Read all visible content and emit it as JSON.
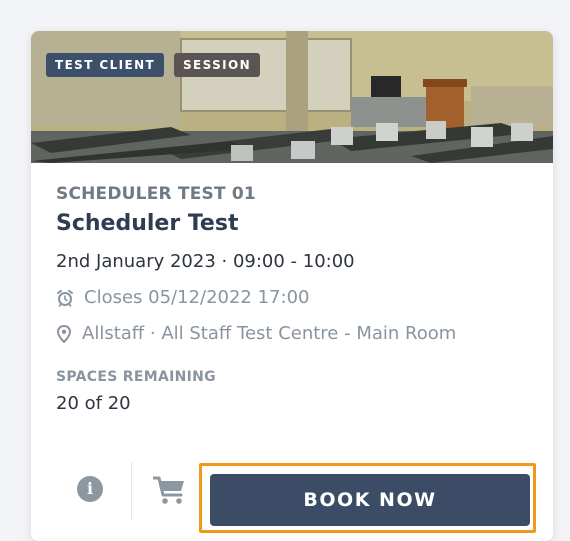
{
  "tags": {
    "client": "TEST CLIENT",
    "session": "SESSION"
  },
  "event": {
    "code": "SCHEDULER TEST 01",
    "title": "Scheduler Test",
    "datetime": "2nd January 2023 · 09:00 - 10:00",
    "closes": "Closes 05/12/2022 17:00",
    "location": "Allstaff · All Staff Test Centre - Main Room"
  },
  "spaces": {
    "label": "SPACES REMAINING",
    "value": "20 of 20"
  },
  "actions": {
    "info_glyph": "i",
    "book_label": "BOOK NOW"
  },
  "icons": {
    "closes": "alarm-clock-icon",
    "location": "map-marker-icon",
    "info": "info-circle-icon",
    "cart": "shopping-cart-icon"
  },
  "colors": {
    "primary": "#3c4c66",
    "focus_outline": "#f19a1a",
    "muted_text": "#8a949f",
    "tag_client": "#3c4f6b",
    "tag_session": "#5a5552"
  }
}
